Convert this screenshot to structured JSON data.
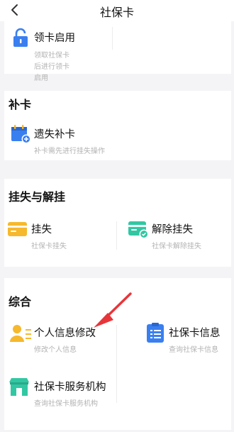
{
  "nav": {
    "title": "社保卡",
    "back_icon": "chevron-left-icon"
  },
  "activate": {
    "label": "领卡启用",
    "desc": [
      "领取社保卡",
      "后进行领卡",
      "启用"
    ],
    "icon": "lock-icon"
  },
  "reissue": {
    "section": "补卡",
    "label": "遗失补卡",
    "desc": "补卡需先进行挂失操作",
    "icon": "calendar-add-icon"
  },
  "loss": {
    "section": "挂失与解挂",
    "report": {
      "label": "挂失",
      "desc": "社保卡挂失",
      "icon": "card-icon"
    },
    "cancel": {
      "label": "解除挂失",
      "desc": "社保卡解除挂失",
      "icon": "card-unlock-icon"
    }
  },
  "general": {
    "section": "综合",
    "personal": {
      "label": "个人信息修改",
      "desc": "修改个人信息",
      "icon": "user-edit-icon"
    },
    "cardinfo": {
      "label": "社保卡信息",
      "desc": "查询社保卡信息",
      "icon": "clipboard-icon"
    },
    "service": {
      "label": "社保卡服务机构",
      "desc": "查询社保卡服务机构",
      "icon": "building-icon"
    }
  },
  "colors": {
    "accent_blue": "#3a7ff0",
    "accent_yellow": "#f6b82c",
    "accent_green": "#32c7a3",
    "arrow_red": "#e8353a"
  }
}
